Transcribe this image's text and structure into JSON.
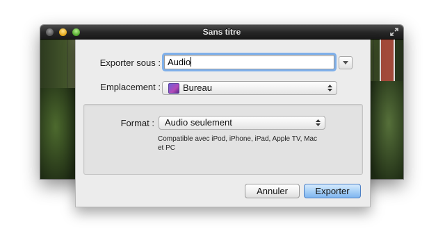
{
  "window": {
    "title": "Sans titre"
  },
  "dialog": {
    "export_as_label": "Exporter sous :",
    "export_as_value": "Audio",
    "location_label": "Emplacement :",
    "location_value": "Bureau",
    "format_label": "Format :",
    "format_value": "Audio seulement",
    "format_description": "Compatible avec iPod, iPhone, iPad, Apple TV, Mac et PC",
    "cancel_label": "Annuler",
    "export_label": "Exporter"
  },
  "icons": {
    "window_controls": [
      "close-icon",
      "minimize-icon",
      "zoom-icon"
    ],
    "fullscreen": "fullscreen-icon",
    "location": "desktop-folder-icon",
    "disclosure": "chevron-down-icon",
    "popup_arrows": "updown-arrows-icon"
  },
  "colors": {
    "default_button": "#8fc0f1",
    "focus_ring": "#7fb0ea",
    "sheet_background": "#ececec"
  }
}
